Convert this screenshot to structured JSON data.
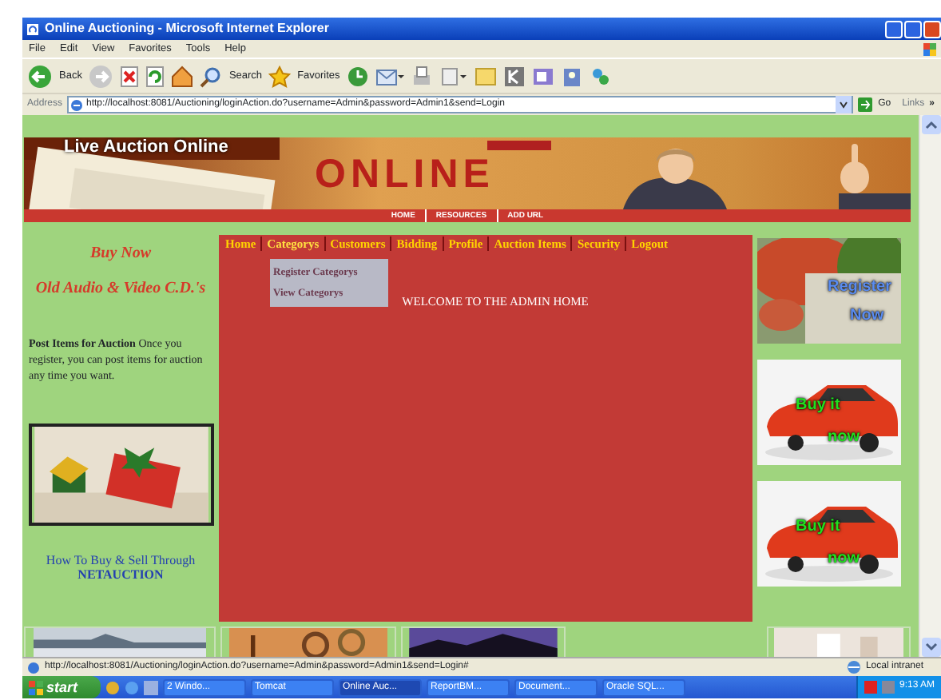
{
  "window": {
    "title": "Online Auctioning - Microsoft Internet Explorer"
  },
  "menu_bar": [
    "File",
    "Edit",
    "View",
    "Favorites",
    "Tools",
    "Help"
  ],
  "toolbar": {
    "back": "Back",
    "search": "Search",
    "favorites": "Favorites"
  },
  "address_bar": {
    "label": "Address",
    "url": "http://localhost:8081/Auctioning/loginAction.do?username=Admin&password=Admin1&send=Login",
    "go": "Go",
    "links": "Links",
    "more": "»"
  },
  "banner": {
    "title": "Live Auction Online",
    "logo": "ONLINE",
    "nav": [
      "HOME",
      "RESOURCES",
      "ADD URL"
    ]
  },
  "left_column": {
    "headline": "Buy Now",
    "subhead": "Old Audio & Video C.D.'s",
    "promo": "**Post Items for Auction** Once you register, you can post items for auction any time you want.",
    "link": "How To Buy & Sell Through",
    "link_strong": "NETAUCTION"
  },
  "nav": [
    {
      "label": "Home",
      "expanded": false
    },
    {
      "label": "Categorys",
      "expanded": true
    },
    {
      "label": "Customers",
      "expanded": false
    },
    {
      "label": "Bidding",
      "expanded": false
    },
    {
      "label": "Profile",
      "expanded": false
    },
    {
      "label": "Auction Items",
      "expanded": false
    },
    {
      "label": "Security",
      "expanded": false
    },
    {
      "label": "Logout",
      "expanded": false
    }
  ],
  "dropdown": [
    "Register Categorys",
    "View Categorys"
  ],
  "welcome": "WELCOME TO THE ADMIN HOME",
  "ads": [
    {
      "kind": "forest",
      "lines": [
        "Register",
        "Now"
      ]
    },
    {
      "kind": "car",
      "lines": [
        "Buy it",
        "now"
      ]
    },
    {
      "kind": "car",
      "lines": [
        "Buy it",
        "now"
      ]
    }
  ],
  "status_bar": {
    "url": "http://localhost:8081/Auctioning/loginAction.do?username=Admin&password=Admin1&send=Login#",
    "zone": "Local intranet"
  },
  "taskbar": {
    "start": "start",
    "tasks": [
      {
        "label": "2 Windo...",
        "selected": false
      },
      {
        "label": "Tomcat",
        "selected": false
      },
      {
        "label": "Online Auc...",
        "selected": true
      },
      {
        "label": "ReportBM...",
        "selected": false
      },
      {
        "label": "Document...",
        "selected": false
      },
      {
        "label": "Oracle SQL...",
        "selected": false
      }
    ],
    "clock": "9:13 AM"
  }
}
